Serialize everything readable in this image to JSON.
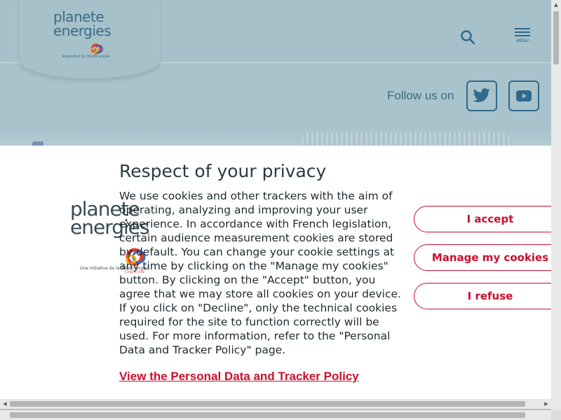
{
  "header": {
    "logo": {
      "line1": "planete",
      "line2": "energies",
      "supported_by": "Supported by TotalEnergies"
    },
    "search_icon": "search-icon",
    "menu": {
      "icon": "hamburger-icon",
      "label": "MENU"
    }
  },
  "social": {
    "follow_label": "Follow us on",
    "twitter_icon": "twitter-icon",
    "youtube_icon": "youtube-icon"
  },
  "cookie_banner": {
    "logo": {
      "line1": "planete",
      "line2": "energies",
      "initiative": "Une initiative de la TotalEnergies",
      "fondation": "FONDATION"
    },
    "title": "Respect of your privacy",
    "body": "We use cookies and other trackers with the aim of operating, analyzing and improving your user experience. In accordance with French legislation, certain audience measurement cookies are stored by default. You can change your cookie settings at any time by clicking on the \"Manage my cookies\" button. By clicking on the \"Accept\" button, you agree that we may store all cookies on your device. If you click on \"Decline\", only the technical cookies required for the site to function correctly will be used. For more information, refer to the \"Personal Data and Tracker Policy\" page.",
    "policy_link": "View the Personal Data and Tracker Policy",
    "buttons": {
      "accept": "I accept",
      "manage": "Manage my cookies",
      "refuse": "I refuse"
    }
  },
  "colors": {
    "header_bg": "#a6c1ca",
    "brand_blue": "#2f6a8c",
    "accent_red": "#c8102e",
    "banner_bg": "#ffffff"
  }
}
